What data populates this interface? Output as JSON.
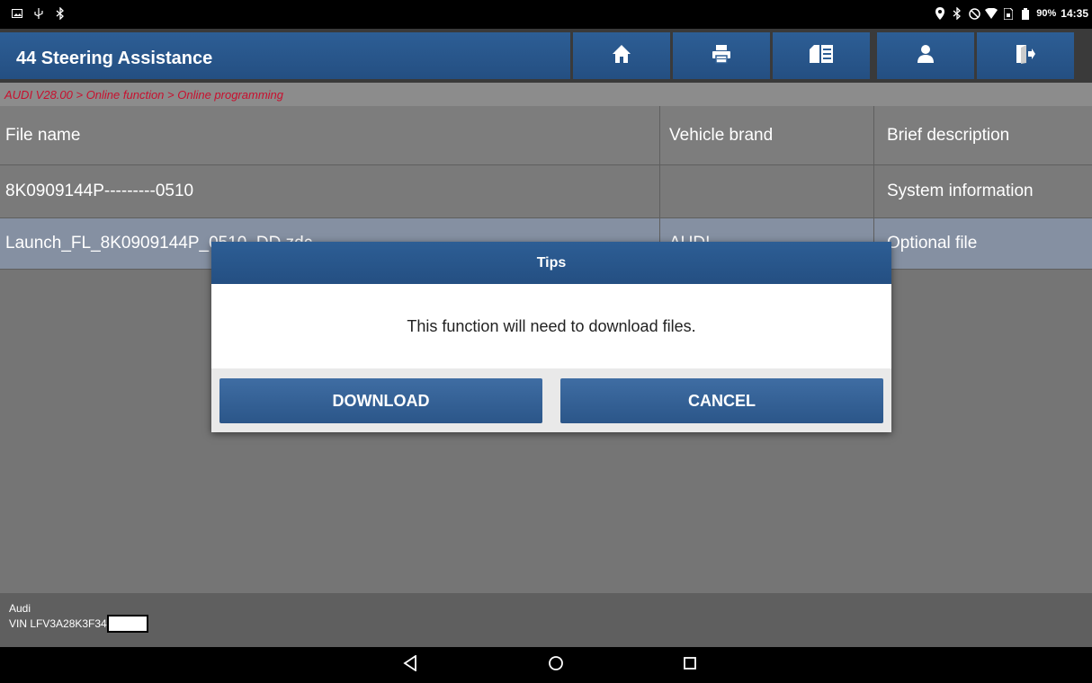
{
  "status_bar": {
    "battery": "90%",
    "time": "14:35"
  },
  "header": {
    "title": "44 Steering Assistance",
    "buttons": [
      "home-icon",
      "print-icon",
      "report-icon",
      "user-icon",
      "exit-icon"
    ]
  },
  "breadcrumb": "AUDI V28.00 > Online function > Online programming",
  "table": {
    "columns": [
      "File name",
      "Vehicle brand",
      "Brief description"
    ],
    "rows": [
      {
        "file": "8K0909144P---------0510",
        "brand": "",
        "desc": "System information"
      },
      {
        "file": "Launch_FL_8K0909144P_0510_DD.zdc",
        "brand": "AUDI",
        "desc": "Optional file"
      }
    ]
  },
  "vehicle": {
    "make": "Audi",
    "vin_label": "VIN LFV3A28K3F34"
  },
  "dialog": {
    "title": "Tips",
    "message": "This function will need to download files.",
    "download_label": "DOWNLOAD",
    "cancel_label": "CANCEL"
  },
  "colors": {
    "header_blue": "#2d5e95",
    "breadcrumb_red": "#c8102e",
    "background_gray": "#757575"
  }
}
